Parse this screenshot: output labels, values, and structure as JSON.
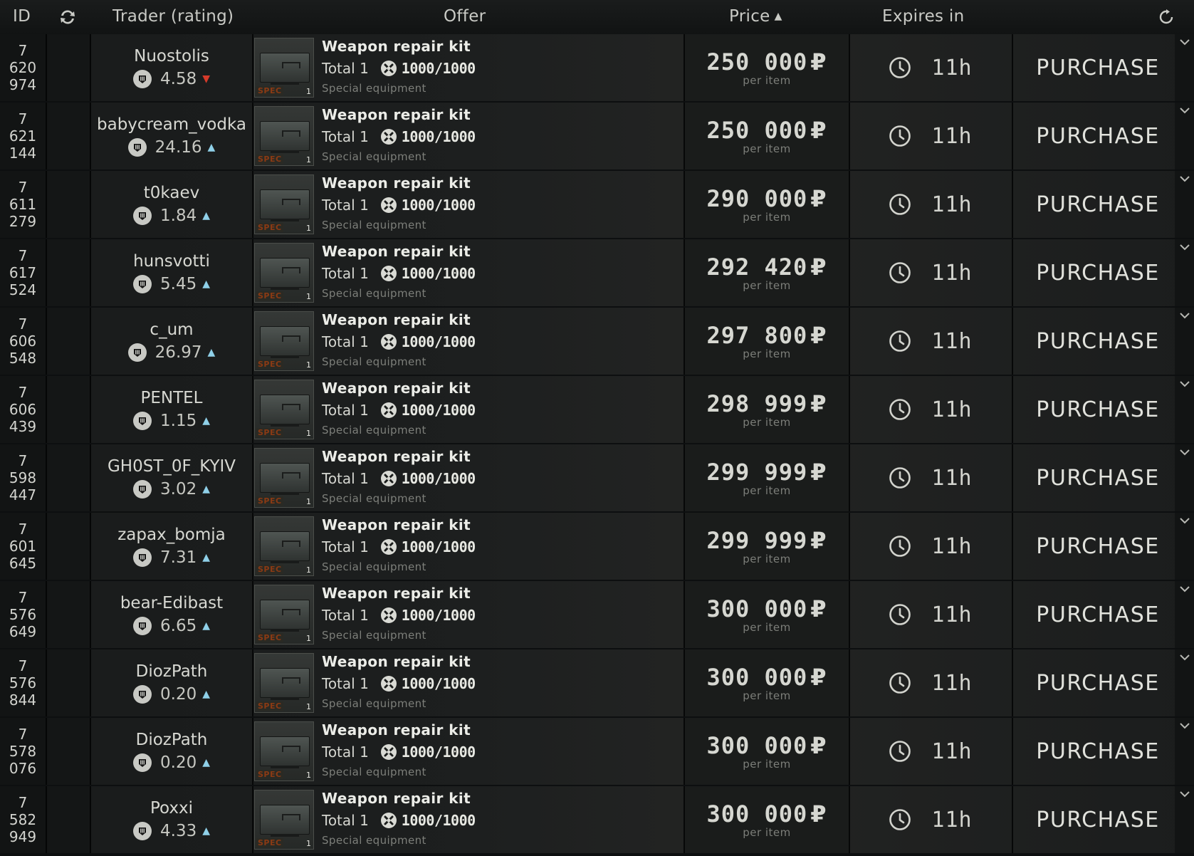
{
  "header": {
    "id_label": "ID",
    "trader_label": "Trader (rating)",
    "offer_label": "Offer",
    "price_label": "Price",
    "price_sort": "ascending",
    "expires_label": "Expires in",
    "swap_icon": "swap-icon",
    "refresh_icon": "refresh-icon"
  },
  "offers": [
    {
      "id": [
        "7",
        "620",
        "974"
      ],
      "trader": "Nuostolis",
      "rating": "4.58",
      "trend": "down",
      "item": "Weapon repair kit",
      "total_label": "Total 1",
      "durability": "1000/1000",
      "category": "Special equipment",
      "price": "250 000",
      "currency": "₽",
      "per": "per item",
      "expires": "11h",
      "action": "PURCHASE",
      "badge": "SPEC",
      "qty": "1"
    },
    {
      "id": [
        "7",
        "621",
        "144"
      ],
      "trader": "babycream_vodka",
      "rating": "24.16",
      "trend": "up",
      "item": "Weapon repair kit",
      "total_label": "Total 1",
      "durability": "1000/1000",
      "category": "Special equipment",
      "price": "250 000",
      "currency": "₽",
      "per": "per item",
      "expires": "11h",
      "action": "PURCHASE",
      "badge": "SPEC",
      "qty": "1"
    },
    {
      "id": [
        "7",
        "611",
        "279"
      ],
      "trader": "t0kaev",
      "rating": "1.84",
      "trend": "up",
      "item": "Weapon repair kit",
      "total_label": "Total 1",
      "durability": "1000/1000",
      "category": "Special equipment",
      "price": "290 000",
      "currency": "₽",
      "per": "per item",
      "expires": "11h",
      "action": "PURCHASE",
      "badge": "SPEC",
      "qty": "1"
    },
    {
      "id": [
        "7",
        "617",
        "524"
      ],
      "trader": "hunsvotti",
      "rating": "5.45",
      "trend": "up",
      "item": "Weapon repair kit",
      "total_label": "Total 1",
      "durability": "1000/1000",
      "category": "Special equipment",
      "price": "292 420",
      "currency": "₽",
      "per": "per item",
      "expires": "11h",
      "action": "PURCHASE",
      "badge": "SPEC",
      "qty": "1"
    },
    {
      "id": [
        "7",
        "606",
        "548"
      ],
      "trader": "c_um",
      "rating": "26.97",
      "trend": "up",
      "item": "Weapon repair kit",
      "total_label": "Total 1",
      "durability": "1000/1000",
      "category": "Special equipment",
      "price": "297 800",
      "currency": "₽",
      "per": "per item",
      "expires": "11h",
      "action": "PURCHASE",
      "badge": "SPEC",
      "qty": "1"
    },
    {
      "id": [
        "7",
        "606",
        "439"
      ],
      "trader": "PENTEL",
      "rating": "1.15",
      "trend": "up",
      "item": "Weapon repair kit",
      "total_label": "Total 1",
      "durability": "1000/1000",
      "category": "Special equipment",
      "price": "298 999",
      "currency": "₽",
      "per": "per item",
      "expires": "11h",
      "action": "PURCHASE",
      "badge": "SPEC",
      "qty": "1"
    },
    {
      "id": [
        "7",
        "598",
        "447"
      ],
      "trader": "GH0ST_0F_KYIV",
      "rating": "3.02",
      "trend": "up",
      "item": "Weapon repair kit",
      "total_label": "Total 1",
      "durability": "1000/1000",
      "category": "Special equipment",
      "price": "299 999",
      "currency": "₽",
      "per": "per item",
      "expires": "11h",
      "action": "PURCHASE",
      "badge": "SPEC",
      "qty": "1"
    },
    {
      "id": [
        "7",
        "601",
        "645"
      ],
      "trader": "zapax_bomja",
      "rating": "7.31",
      "trend": "up",
      "item": "Weapon repair kit",
      "total_label": "Total 1",
      "durability": "1000/1000",
      "category": "Special equipment",
      "price": "299 999",
      "currency": "₽",
      "per": "per item",
      "expires": "11h",
      "action": "PURCHASE",
      "badge": "SPEC",
      "qty": "1"
    },
    {
      "id": [
        "7",
        "576",
        "649"
      ],
      "trader": "bear-Edibast",
      "rating": "6.65",
      "trend": "up",
      "item": "Weapon repair kit",
      "total_label": "Total 1",
      "durability": "1000/1000",
      "category": "Special equipment",
      "price": "300 000",
      "currency": "₽",
      "per": "per item",
      "expires": "11h",
      "action": "PURCHASE",
      "badge": "SPEC",
      "qty": "1"
    },
    {
      "id": [
        "7",
        "576",
        "844"
      ],
      "trader": "DiozPath",
      "rating": "0.20",
      "trend": "up",
      "item": "Weapon repair kit",
      "total_label": "Total 1",
      "durability": "1000/1000",
      "category": "Special equipment",
      "price": "300 000",
      "currency": "₽",
      "per": "per item",
      "expires": "11h",
      "action": "PURCHASE",
      "badge": "SPEC",
      "qty": "1"
    },
    {
      "id": [
        "7",
        "578",
        "076"
      ],
      "trader": "DiozPath",
      "rating": "0.20",
      "trend": "up",
      "item": "Weapon repair kit",
      "total_label": "Total 1",
      "durability": "1000/1000",
      "category": "Special equipment",
      "price": "300 000",
      "currency": "₽",
      "per": "per item",
      "expires": "11h",
      "action": "PURCHASE",
      "badge": "SPEC",
      "qty": "1"
    },
    {
      "id": [
        "7",
        "582",
        "949"
      ],
      "trader": "Poxxi",
      "rating": "4.33",
      "trend": "up",
      "item": "Weapon repair kit",
      "total_label": "Total 1",
      "durability": "1000/1000",
      "category": "Special equipment",
      "price": "300 000",
      "currency": "₽",
      "per": "per item",
      "expires": "11h",
      "action": "PURCHASE",
      "badge": "SPEC",
      "qty": "1"
    }
  ],
  "colors": {
    "trend_up": "#8fd0e8",
    "trend_down": "#d63a2a",
    "spec_badge": "#8a3a14"
  }
}
